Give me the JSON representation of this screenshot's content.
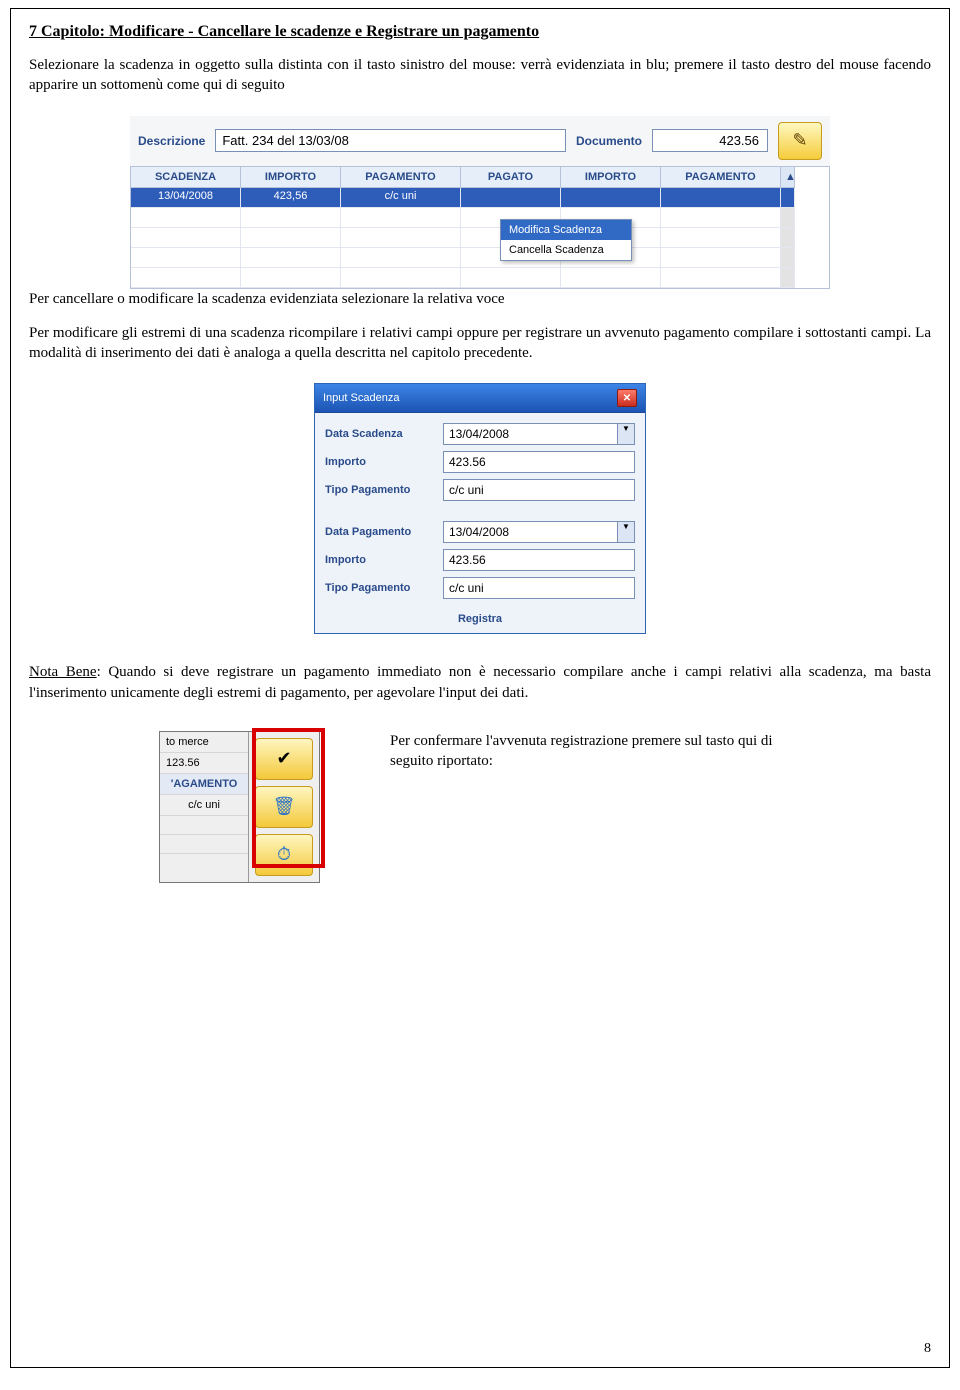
{
  "chapter_title": "7 Capitolo: Modificare - Cancellare le scadenze e Registrare un pagamento",
  "para1": "Selezionare la scadenza in oggetto sulla distinta con il tasto sinistro del mouse: verrà evidenziata in blu; premere il tasto destro del mouse facendo apparire un sottomenù come qui di seguito",
  "para2": "Per cancellare o modificare la scadenza evidenziata selezionare la relativa voce",
  "para3": "Per modificare gli estremi di una scadenza ricompilare i relativi campi oppure per registrare un avvenuto pagamento compilare i sottostanti campi. La modalità di inserimento dei dati è analoga a quella descritta nel capitolo precedente.",
  "nota_bene_lead": "Nota Bene",
  "nota_bene": ": Quando si deve registrare un pagamento immediato non è necessario compilare anche i campi relativi alla scadenza, ma basta l'inserimento unicamente degli estremi di pagamento, per agevolare l'input dei dati.",
  "confirm_text": "Per confermare l'avvenuta registrazione premere sul tasto qui di seguito riportato:",
  "page_number": "8",
  "shot1": {
    "desc_label": "Descrizione",
    "desc_value": "Fatt. 234 del 13/03/08",
    "doc_label": "Documento",
    "doc_value": "423.56",
    "cols": [
      "SCADENZA",
      "IMPORTO",
      "PAGAMENTO",
      "PAGATO",
      "IMPORTO",
      "PAGAMENTO"
    ],
    "row": {
      "scadenza": "13/04/2008",
      "importo": "423,56",
      "pagamento": "c/c uni",
      "pagato": "",
      "importo2": "",
      "pagamento2": ""
    },
    "menu": {
      "item1": "Modifica Scadenza",
      "item2": "Cancella Scadenza"
    }
  },
  "shot2": {
    "title": "Input Scadenza",
    "labels": {
      "data_scad": "Data Scadenza",
      "importo": "Importo",
      "tipo": "Tipo Pagamento",
      "data_pag": "Data Pagamento",
      "importo2": "Importo",
      "tipo2": "Tipo Pagamento"
    },
    "values": {
      "data_scad": "13/04/2008",
      "importo": "423.56",
      "tipo": "c/c uni",
      "data_pag": "13/04/2008",
      "importo2": "423.56",
      "tipo2": "c/c uni"
    },
    "register": "Registra"
  },
  "shot3": {
    "line1": "to merce",
    "line2": "123.56",
    "head": "'AGAMENTO",
    "cell": "c/c uni"
  }
}
